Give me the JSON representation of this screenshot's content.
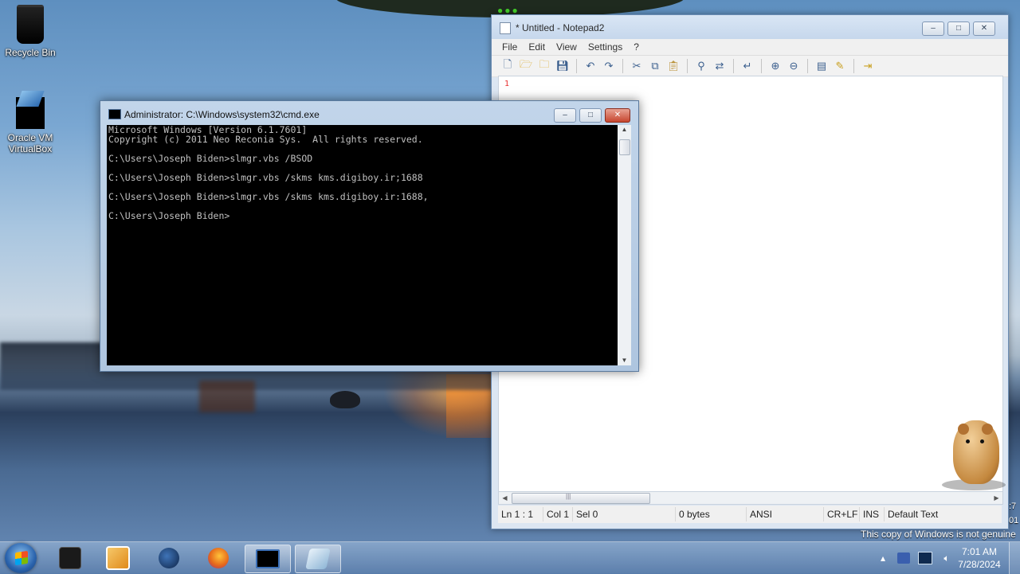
{
  "desktop": {
    "icons": [
      {
        "label": "Recycle Bin",
        "icon": "recycle-bin-icon"
      },
      {
        "label": "Oracle VM\nVirtualBox",
        "label_line1": "Oracle VM",
        "label_line2": "VirtualBox",
        "icon": "virtualbox-icon"
      }
    ],
    "watermark": "This copy of Windows is not genuine",
    "edge_text_1": ":7",
    "edge_text_2": "01"
  },
  "notepad": {
    "title": "* Untitled - Notepad2",
    "menu": [
      "File",
      "Edit",
      "View",
      "Settings",
      "?"
    ],
    "toolbar_icons": [
      "new-file-icon",
      "open-folder-icon",
      "browse-icon",
      "save-icon",
      "undo-icon",
      "redo-icon",
      "cut-icon",
      "copy-icon",
      "paste-icon",
      "find-icon",
      "replace-icon",
      "word-wrap-icon",
      "zoom-in-icon",
      "zoom-out-icon",
      "scheme-icon",
      "customize-icon",
      "exit-icon"
    ],
    "line_number": "1",
    "status": {
      "position": "Ln 1 : 1",
      "col": "Col 1",
      "sel": "Sel 0",
      "size": "0 bytes",
      "encoding": "ANSI",
      "eol": "CR+LF",
      "mode": "INS",
      "scheme": "Default Text"
    },
    "window_buttons": {
      "minimize": "–",
      "maximize": "□",
      "close": "✕"
    }
  },
  "cmd": {
    "title": "Administrator: C:\\Windows\\system32\\cmd.exe",
    "lines": [
      "Microsoft Windows [Version 6.1.7601]",
      "Copyright (c) 2011 Neo Reconia Sys.  All rights reserved.",
      "",
      "C:\\Users\\Joseph Biden>slmgr.vbs /BSOD",
      "",
      "C:\\Users\\Joseph Biden>slmgr.vbs /skms kms.digiboy.ir;1688",
      "",
      "C:\\Users\\Joseph Biden>slmgr.vbs /skms kms.digiboy.ir:1688,",
      "",
      "C:\\Users\\Joseph Biden>"
    ],
    "window_buttons": {
      "minimize": "–",
      "maximize": "□",
      "close": "✕"
    }
  },
  "taskbar": {
    "apps": [
      {
        "name": "taskbar-app-virtualbox",
        "icon": "virtualbox-icon",
        "color": "#1a1a1a"
      },
      {
        "name": "taskbar-app-media-player",
        "icon": "media-player-icon",
        "color": "#e8a030"
      },
      {
        "name": "taskbar-app-globe",
        "icon": "globe-icon",
        "color": "#1a3c6e"
      },
      {
        "name": "taskbar-app-firefox",
        "icon": "firefox-icon",
        "color": "#e66a1a"
      },
      {
        "name": "taskbar-app-cmd",
        "icon": "cmd-icon",
        "color": "#0a2a5a"
      },
      {
        "name": "taskbar-app-notepad2",
        "icon": "notepad-icon",
        "color": "#a8c8e0"
      }
    ],
    "tray_icons": [
      "show-hidden-icons-icon",
      "action-center-icon",
      "display-icon",
      "volume-icon"
    ],
    "clock_time": "7:01 AM",
    "clock_date": "7/28/2024"
  }
}
